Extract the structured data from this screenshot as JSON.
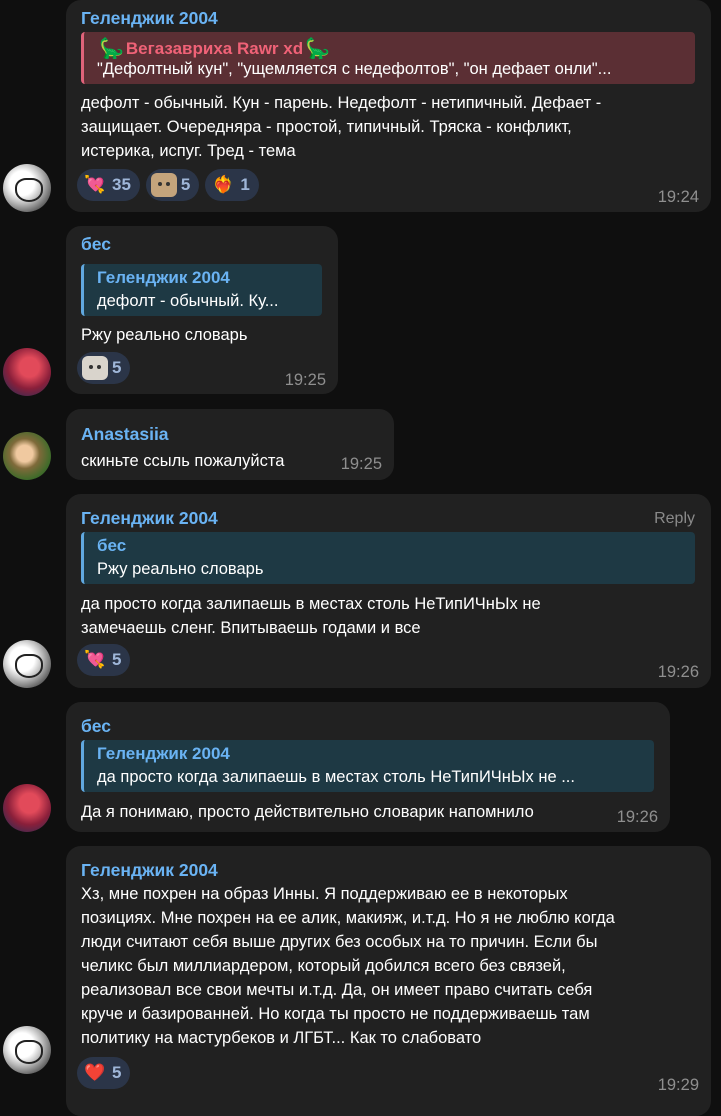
{
  "messages": [
    {
      "sender": "Геленджик 2004",
      "quote": {
        "name": "Вегазавриха Rawr xd",
        "emoji_left": "🦕",
        "emoji_right": "🦕",
        "text": "\"Дефолтный кун\", \"ущемляется с недефолтов\", \"он дефает онли\"..."
      },
      "lines": [
        "дефолт - обычный. Кун - парень. Недефолт - нетипичный. Дефает -",
        "защищает. Очередняра - простой, типичный. Тряска - конфликт,",
        "истерика, испуг. Тред - тема"
      ],
      "reactions": [
        {
          "icon": "heart-arrow-icon",
          "glyph": "💘",
          "count": "35"
        },
        {
          "icon": "cat-sticker-icon",
          "glyph": "",
          "count": "5"
        },
        {
          "icon": "fire-heart-icon",
          "glyph": "❤️‍🔥",
          "count": "1"
        }
      ],
      "time": "19:24"
    },
    {
      "sender": "бес",
      "quote": {
        "name": "Геленджик 2004",
        "text": "дефолт - обычный. Ку..."
      },
      "lines": [
        "Ржу реально словарь"
      ],
      "reactions": [
        {
          "icon": "cat-sticker-icon",
          "glyph": "",
          "count": "5"
        }
      ],
      "time": "19:25"
    },
    {
      "sender": "Anastasiia",
      "lines": [
        "скиньте ссыль пожалуйста"
      ],
      "time": "19:25"
    },
    {
      "sender": "Геленджик 2004",
      "reply_label": "Reply",
      "quote": {
        "name": "бес",
        "text": "Ржу реально словарь"
      },
      "lines": [
        "да просто когда залипаешь в местах столь НеТипИЧнЫх не",
        "замечаешь сленг. Впитываешь годами и все"
      ],
      "reactions": [
        {
          "icon": "heart-arrow-icon",
          "glyph": "💘",
          "count": "5"
        }
      ],
      "time": "19:26"
    },
    {
      "sender": "бес",
      "quote": {
        "name": "Геленджик 2004",
        "text": "да просто когда залипаешь в местах столь НеТипИЧнЫх не ..."
      },
      "lines": [
        "Да я понимаю, просто действительно словарик напомнило"
      ],
      "time": "19:26"
    },
    {
      "sender": "Геленджик 2004",
      "lines": [
        "Хз, мне похрен на образ Инны. Я поддерживаю ее в некоторых",
        "позициях. Мне похрен на ее алик, макияж, и.т.д. Но я не люблю когда",
        "люди считают себя выше других без особых на то причин. Если бы",
        "челикс был миллиардером, который добился всего без связей,",
        "реализовал все свои мечты и.т.д. Да, он имеет право считать себя",
        "круче и базированней. Но когда ты просто не поддерживаешь там",
        "политику на мастурбеков и ЛГБТ... Как то слабовато"
      ],
      "reactions": [
        {
          "icon": "red-heart-icon",
          "glyph": "❤️",
          "count": "5"
        }
      ],
      "time": "19:29"
    }
  ]
}
